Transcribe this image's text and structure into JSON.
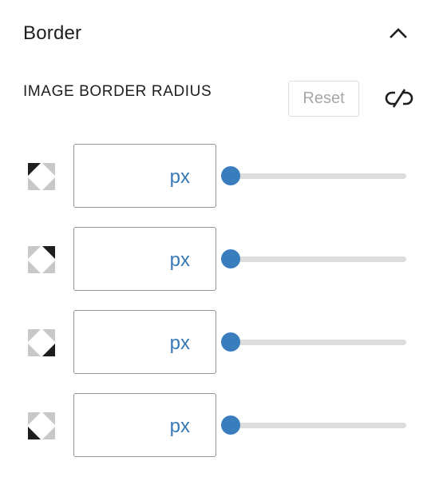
{
  "panel": {
    "title": "Border",
    "collapse_icon": "chevron-up-icon",
    "accent_color": "#3a7dbf"
  },
  "radius": {
    "label": "IMAGE BORDER RADIUS",
    "reset_label": "Reset",
    "link_icon": "unlink-icon",
    "corners": [
      {
        "name": "top-left",
        "value": "",
        "unit": "px",
        "slider_value": 0
      },
      {
        "name": "top-right",
        "value": "",
        "unit": "px",
        "slider_value": 0
      },
      {
        "name": "bottom-right",
        "value": "",
        "unit": "px",
        "slider_value": 0
      },
      {
        "name": "bottom-left",
        "value": "",
        "unit": "px",
        "slider_value": 0
      }
    ]
  }
}
